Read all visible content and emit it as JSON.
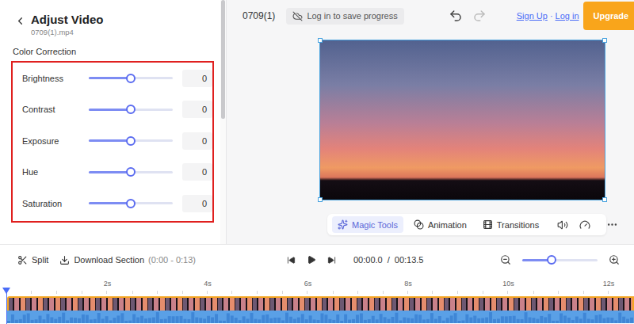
{
  "editor": {
    "title": "Adjust Video",
    "file": "0709(1).mp4"
  },
  "section": {
    "title": "Color Correction"
  },
  "color_correction": {
    "highlighted": true,
    "sliders": [
      {
        "label": "Brightness",
        "value": "0",
        "level": 0.5
      },
      {
        "label": "Contrast",
        "value": "0",
        "level": 0.5
      },
      {
        "label": "Exposure",
        "value": "0",
        "level": 0.5
      },
      {
        "label": "Hue",
        "value": "0",
        "level": 0.5
      },
      {
        "label": "Saturation",
        "value": "0",
        "level": 0.5
      }
    ]
  },
  "top_bar": {
    "project": "0709(1)",
    "save_button": "Log in to save progress",
    "undo_enabled": true,
    "redo_enabled": false,
    "sign_up": "Sign Up",
    "link_separator": "·",
    "log_in": "Log in",
    "upgrade": "Upgrade"
  },
  "preview": {
    "selected": true
  },
  "toolbar": {
    "tools": [
      {
        "label": "Magic Tools",
        "selected": true
      },
      {
        "label": "Animation",
        "selected": false
      },
      {
        "label": "Transitions",
        "selected": false
      }
    ]
  },
  "timeline": {
    "split": "Split",
    "download": "Download Section",
    "download_range": "(0:00 - 0:13)",
    "current_time": "00:00.0",
    "time_separator": "/",
    "total_time": "00:13.5",
    "zoom_level": 0.39,
    "ruler": [
      "2s",
      "4s",
      "6s",
      "8s",
      "10s",
      "12s"
    ],
    "playhead_level": 0
  }
}
